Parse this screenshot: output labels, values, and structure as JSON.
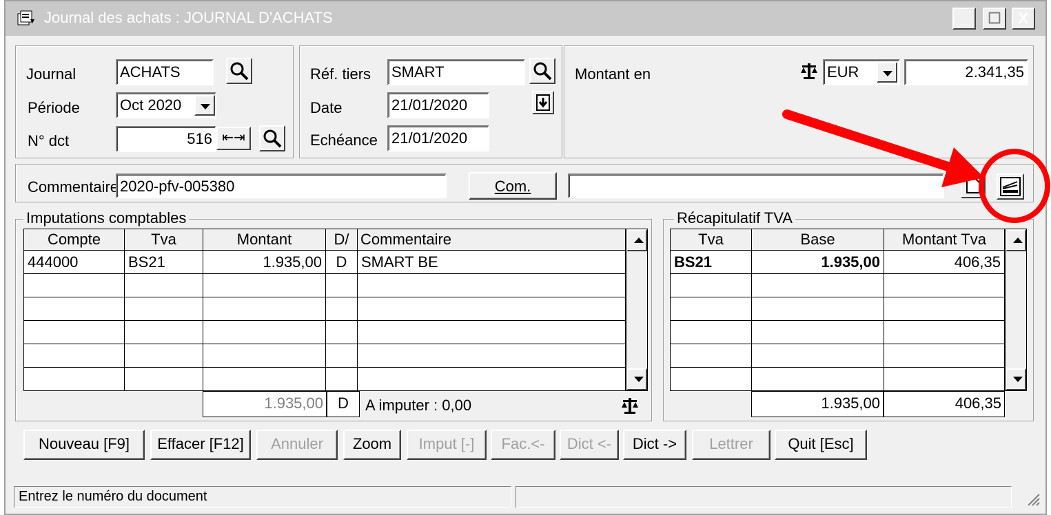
{
  "window": {
    "title": "Journal des achats : JOURNAL D'ACHATS",
    "minimize": "_",
    "maximize": "☐",
    "close": "X"
  },
  "header": {
    "journal_label": "Journal",
    "journal_value": "ACHATS",
    "periode_label": "Période",
    "periode_value": "Oct 2020",
    "ndct_label": "N° dct",
    "ndct_value": "516",
    "ref_tiers_label": "Réf. tiers",
    "ref_tiers_value": "SMART",
    "date_label": "Date",
    "date_value": "21/01/2020",
    "echeance_label": "Echéance",
    "echeance_value": "21/01/2020",
    "montant_label": "Montant en",
    "currency": "EUR",
    "montant_value": "2.341,35"
  },
  "comment": {
    "label": "Commentaire",
    "value": "2020-pfv-005380",
    "com_button": "Com.",
    "extra_value": ""
  },
  "imputations": {
    "legend": "Imputations comptables",
    "columns": [
      "Compte",
      "Tva",
      "Montant",
      "D/",
      "Commentaire"
    ],
    "rows": [
      [
        "444000",
        "BS21",
        "1.935,00",
        "D",
        "SMART BE"
      ],
      [
        "",
        "",
        "",
        "",
        ""
      ],
      [
        "",
        "",
        "",
        "",
        ""
      ],
      [
        "",
        "",
        "",
        "",
        ""
      ],
      [
        "",
        "",
        "",
        "",
        ""
      ],
      [
        "",
        "",
        "",
        "",
        ""
      ]
    ],
    "total": "1.935,00",
    "total_dc": "D",
    "a_imputer": "A imputer : 0,00"
  },
  "tva": {
    "legend": "Récapitulatif TVA",
    "columns": [
      "Tva",
      "Base",
      "Montant Tva"
    ],
    "rows": [
      [
        "BS21",
        "1.935,00",
        "406,35"
      ],
      [
        "",
        "",
        ""
      ],
      [
        "",
        "",
        ""
      ],
      [
        "",
        "",
        ""
      ],
      [
        "",
        "",
        ""
      ],
      [
        "",
        "",
        ""
      ]
    ],
    "total_base": "1.935,00",
    "total_tva": "406,35"
  },
  "buttons": {
    "nouveau": "Nouveau [F9]",
    "effacer": "Effacer [F12]",
    "annuler": "Annuler",
    "zoom": "Zoom",
    "imput": "Imput [-]",
    "fac": "Fac.<-",
    "dict_prev": "Dict <-",
    "dict_next": "Dict ->",
    "lettrer": "Lettrer",
    "quit": "Quit [Esc]"
  },
  "status": {
    "message": "Entrez le numéro du document",
    "panel2": ""
  },
  "colors": {
    "annotation": "#ff0000",
    "titlebar": "#c9c9c9",
    "face": "#f0f0f0"
  }
}
